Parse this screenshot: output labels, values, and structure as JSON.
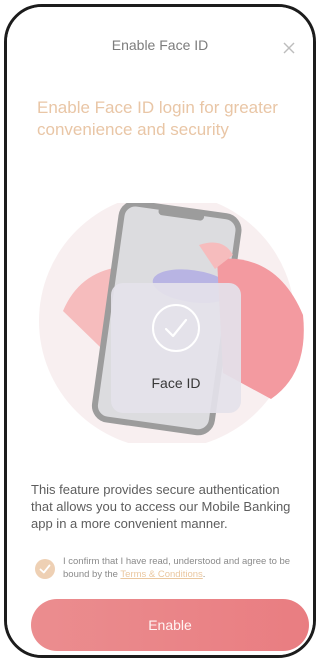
{
  "header": {
    "title": "Enable Face ID"
  },
  "main": {
    "headline": "Enable Face ID login for greater convenience and security",
    "face_card_label": "Face ID",
    "description": "This feature provides secure authentication that allows you to access our Mobile Banking app in a more convenient manner."
  },
  "consent": {
    "text_before_link": "I confirm that I have read, understood and agree to be bound by the ",
    "link_text": "Terms & Conditions",
    "text_after_link": ".",
    "checked": true
  },
  "footer": {
    "enable_label": "Enable"
  },
  "colors": {
    "accent": "#e9c6a6",
    "button": "#e97d81",
    "checkbox": "#eed0b4"
  },
  "icons": {
    "close": "close-icon",
    "check": "checkmark-icon",
    "face_id": "face-id-check-icon"
  }
}
